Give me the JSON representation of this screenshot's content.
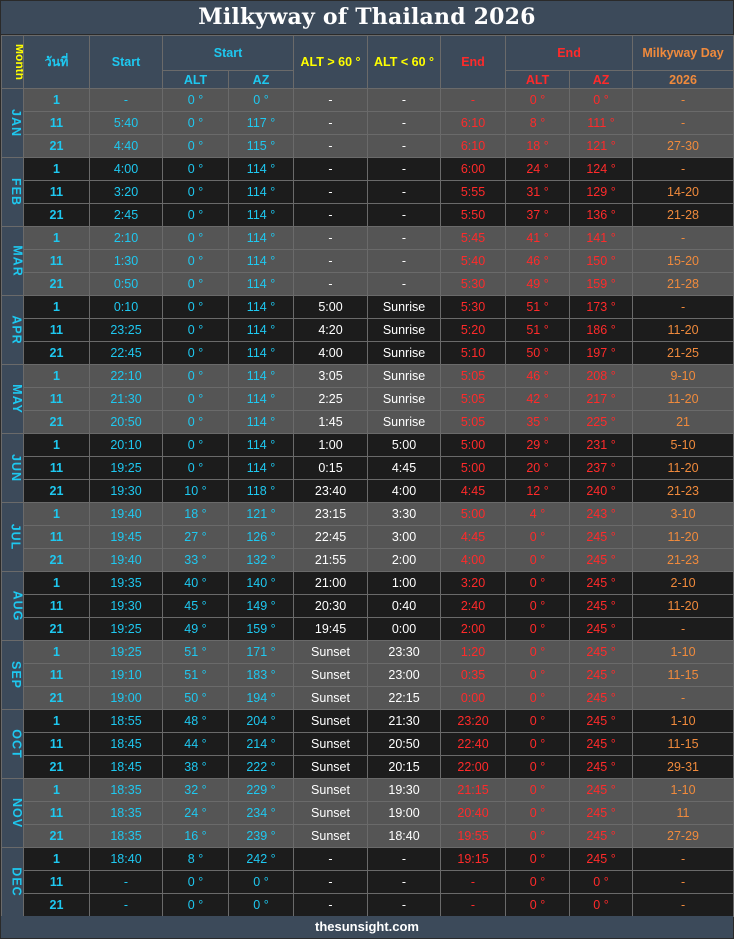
{
  "title": "Milkyway of Thailand 2026",
  "footer": "thesunsight.com",
  "headers": {
    "month": "Month",
    "day": "วันที่",
    "start": "Start",
    "start_group": "Start",
    "alt_gt": "ALT > 60 °",
    "alt_lt": "ALT < 60 °",
    "end": "End",
    "end_group": "End",
    "milkyway_day": "Milkyway Day",
    "start_alt": "ALT",
    "start_az": "AZ",
    "end_alt": "ALT",
    "end_az": "AZ",
    "year": "2026"
  },
  "months": [
    {
      "name": "JAN",
      "rows": [
        {
          "day": "1",
          "start": "-",
          "s_alt": "0 °",
          "s_az": "0 °",
          "gt": "-",
          "lt": "-",
          "end": "-",
          "e_alt": "0 °",
          "e_az": "0 °",
          "mw": "-"
        },
        {
          "day": "11",
          "start": "5:40",
          "s_alt": "0 °",
          "s_az": "117 °",
          "gt": "-",
          "lt": "-",
          "end": "6:10",
          "e_alt": "8 °",
          "e_az": "111 °",
          "mw": "-"
        },
        {
          "day": "21",
          "start": "4:40",
          "s_alt": "0 °",
          "s_az": "115 °",
          "gt": "-",
          "lt": "-",
          "end": "6:10",
          "e_alt": "18 °",
          "e_az": "121 °",
          "mw": "27-30"
        }
      ]
    },
    {
      "name": "FEB",
      "rows": [
        {
          "day": "1",
          "start": "4:00",
          "s_alt": "0 °",
          "s_az": "114 °",
          "gt": "-",
          "lt": "-",
          "end": "6:00",
          "e_alt": "24 °",
          "e_az": "124 °",
          "mw": "-"
        },
        {
          "day": "11",
          "start": "3:20",
          "s_alt": "0 °",
          "s_az": "114 °",
          "gt": "-",
          "lt": "-",
          "end": "5:55",
          "e_alt": "31 °",
          "e_az": "129 °",
          "mw": "14-20"
        },
        {
          "day": "21",
          "start": "2:45",
          "s_alt": "0 °",
          "s_az": "114 °",
          "gt": "-",
          "lt": "-",
          "end": "5:50",
          "e_alt": "37 °",
          "e_az": "136 °",
          "mw": "21-28"
        }
      ]
    },
    {
      "name": "MAR",
      "rows": [
        {
          "day": "1",
          "start": "2:10",
          "s_alt": "0 °",
          "s_az": "114 °",
          "gt": "-",
          "lt": "-",
          "end": "5:45",
          "e_alt": "41 °",
          "e_az": "141 °",
          "mw": "-"
        },
        {
          "day": "11",
          "start": "1:30",
          "s_alt": "0 °",
          "s_az": "114 °",
          "gt": "-",
          "lt": "-",
          "end": "5:40",
          "e_alt": "46 °",
          "e_az": "150 °",
          "mw": "15-20"
        },
        {
          "day": "21",
          "start": "0:50",
          "s_alt": "0 °",
          "s_az": "114 °",
          "gt": "-",
          "lt": "-",
          "end": "5:30",
          "e_alt": "49 °",
          "e_az": "159 °",
          "mw": "21-28"
        }
      ]
    },
    {
      "name": "APR",
      "rows": [
        {
          "day": "1",
          "start": "0:10",
          "s_alt": "0 °",
          "s_az": "114 °",
          "gt": "5:00",
          "lt": "Sunrise",
          "end": "5:30",
          "e_alt": "51 °",
          "e_az": "173 °",
          "mw": "-"
        },
        {
          "day": "11",
          "start": "23:25",
          "s_alt": "0 °",
          "s_az": "114 °",
          "gt": "4:20",
          "lt": "Sunrise",
          "end": "5:20",
          "e_alt": "51 °",
          "e_az": "186 °",
          "mw": "11-20"
        },
        {
          "day": "21",
          "start": "22:45",
          "s_alt": "0 °",
          "s_az": "114 °",
          "gt": "4:00",
          "lt": "Sunrise",
          "end": "5:10",
          "e_alt": "50 °",
          "e_az": "197 °",
          "mw": "21-25"
        }
      ]
    },
    {
      "name": "MAY",
      "rows": [
        {
          "day": "1",
          "start": "22:10",
          "s_alt": "0 °",
          "s_az": "114 °",
          "gt": "3:05",
          "lt": "Sunrise",
          "end": "5:05",
          "e_alt": "46 °",
          "e_az": "208 °",
          "mw": "9-10"
        },
        {
          "day": "11",
          "start": "21:30",
          "s_alt": "0 °",
          "s_az": "114 °",
          "gt": "2:25",
          "lt": "Sunrise",
          "end": "5:05",
          "e_alt": "42 °",
          "e_az": "217 °",
          "mw": "11-20"
        },
        {
          "day": "21",
          "start": "20:50",
          "s_alt": "0 °",
          "s_az": "114 °",
          "gt": "1:45",
          "lt": "Sunrise",
          "end": "5:05",
          "e_alt": "35 °",
          "e_az": "225 °",
          "mw": "21"
        }
      ]
    },
    {
      "name": "JUN",
      "rows": [
        {
          "day": "1",
          "start": "20:10",
          "s_alt": "0 °",
          "s_az": "114 °",
          "gt": "1:00",
          "lt": "5:00",
          "end": "5:00",
          "e_alt": "29 °",
          "e_az": "231 °",
          "mw": "5-10"
        },
        {
          "day": "11",
          "start": "19:25",
          "s_alt": "0 °",
          "s_az": "114 °",
          "gt": "0:15",
          "lt": "4:45",
          "end": "5:00",
          "e_alt": "20 °",
          "e_az": "237 °",
          "mw": "11-20"
        },
        {
          "day": "21",
          "start": "19:30",
          "s_alt": "10 °",
          "s_az": "118 °",
          "gt": "23:40",
          "lt": "4:00",
          "end": "4:45",
          "e_alt": "12 °",
          "e_az": "240 °",
          "mw": "21-23"
        }
      ]
    },
    {
      "name": "JUL",
      "rows": [
        {
          "day": "1",
          "start": "19:40",
          "s_alt": "18 °",
          "s_az": "121 °",
          "gt": "23:15",
          "lt": "3:30",
          "end": "5:00",
          "e_alt": "4 °",
          "e_az": "243 °",
          "mw": "3-10"
        },
        {
          "day": "11",
          "start": "19:45",
          "s_alt": "27 °",
          "s_az": "126 °",
          "gt": "22:45",
          "lt": "3:00",
          "end": "4:45",
          "e_alt": "0 °",
          "e_az": "245 °",
          "mw": "11-20"
        },
        {
          "day": "21",
          "start": "19:40",
          "s_alt": "33 °",
          "s_az": "132 °",
          "gt": "21:55",
          "lt": "2:00",
          "end": "4:00",
          "e_alt": "0 °",
          "e_az": "245 °",
          "mw": "21-23"
        }
      ]
    },
    {
      "name": "AUG",
      "rows": [
        {
          "day": "1",
          "start": "19:35",
          "s_alt": "40 °",
          "s_az": "140 °",
          "gt": "21:00",
          "lt": "1:00",
          "end": "3:20",
          "e_alt": "0 °",
          "e_az": "245 °",
          "mw": "2-10"
        },
        {
          "day": "11",
          "start": "19:30",
          "s_alt": "45 °",
          "s_az": "149 °",
          "gt": "20:30",
          "lt": "0:40",
          "end": "2:40",
          "e_alt": "0 °",
          "e_az": "245 °",
          "mw": "11-20"
        },
        {
          "day": "21",
          "start": "19:25",
          "s_alt": "49 °",
          "s_az": "159 °",
          "gt": "19:45",
          "lt": "0:00",
          "end": "2:00",
          "e_alt": "0 °",
          "e_az": "245 °",
          "mw": "-"
        }
      ]
    },
    {
      "name": "SEP",
      "rows": [
        {
          "day": "1",
          "start": "19:25",
          "s_alt": "51 °",
          "s_az": "171 °",
          "gt": "Sunset",
          "lt": "23:30",
          "end": "1:20",
          "e_alt": "0 °",
          "e_az": "245 °",
          "mw": "1-10"
        },
        {
          "day": "11",
          "start": "19:10",
          "s_alt": "51 °",
          "s_az": "183 °",
          "gt": "Sunset",
          "lt": "23:00",
          "end": "0:35",
          "e_alt": "0 °",
          "e_az": "245 °",
          "mw": "11-15"
        },
        {
          "day": "21",
          "start": "19:00",
          "s_alt": "50 °",
          "s_az": "194 °",
          "gt": "Sunset",
          "lt": "22:15",
          "end": "0:00",
          "e_alt": "0 °",
          "e_az": "245 °",
          "mw": "-"
        }
      ]
    },
    {
      "name": "OCT",
      "rows": [
        {
          "day": "1",
          "start": "18:55",
          "s_alt": "48 °",
          "s_az": "204 °",
          "gt": "Sunset",
          "lt": "21:30",
          "end": "23:20",
          "e_alt": "0 °",
          "e_az": "245 °",
          "mw": "1-10"
        },
        {
          "day": "11",
          "start": "18:45",
          "s_alt": "44 °",
          "s_az": "214 °",
          "gt": "Sunset",
          "lt": "20:50",
          "end": "22:40",
          "e_alt": "0 °",
          "e_az": "245 °",
          "mw": "11-15"
        },
        {
          "day": "21",
          "start": "18:45",
          "s_alt": "38 °",
          "s_az": "222 °",
          "gt": "Sunset",
          "lt": "20:15",
          "end": "22:00",
          "e_alt": "0 °",
          "e_az": "245 °",
          "mw": "29-31"
        }
      ]
    },
    {
      "name": "NOV",
      "rows": [
        {
          "day": "1",
          "start": "18:35",
          "s_alt": "32 °",
          "s_az": "229 °",
          "gt": "Sunset",
          "lt": "19:30",
          "end": "21:15",
          "e_alt": "0 °",
          "e_az": "245 °",
          "mw": "1-10"
        },
        {
          "day": "11",
          "start": "18:35",
          "s_alt": "24 °",
          "s_az": "234 °",
          "gt": "Sunset",
          "lt": "19:00",
          "end": "20:40",
          "e_alt": "0 °",
          "e_az": "245 °",
          "mw": "11"
        },
        {
          "day": "21",
          "start": "18:35",
          "s_alt": "16 °",
          "s_az": "239 °",
          "gt": "Sunset",
          "lt": "18:40",
          "end": "19:55",
          "e_alt": "0 °",
          "e_az": "245 °",
          "mw": "27-29"
        }
      ]
    },
    {
      "name": "DEC",
      "rows": [
        {
          "day": "1",
          "start": "18:40",
          "s_alt": "8 °",
          "s_az": "242 °",
          "gt": "-",
          "lt": "-",
          "end": "19:15",
          "e_alt": "0 °",
          "e_az": "245 °",
          "mw": "-"
        },
        {
          "day": "11",
          "start": "-",
          "s_alt": "0 °",
          "s_az": "0 °",
          "gt": "-",
          "lt": "-",
          "end": "-",
          "e_alt": "0 °",
          "e_az": "0 °",
          "mw": "-"
        },
        {
          "day": "21",
          "start": "-",
          "s_alt": "0 °",
          "s_az": "0 °",
          "gt": "-",
          "lt": "-",
          "end": "-",
          "e_alt": "0 °",
          "e_az": "0 °",
          "mw": "-"
        }
      ]
    }
  ]
}
